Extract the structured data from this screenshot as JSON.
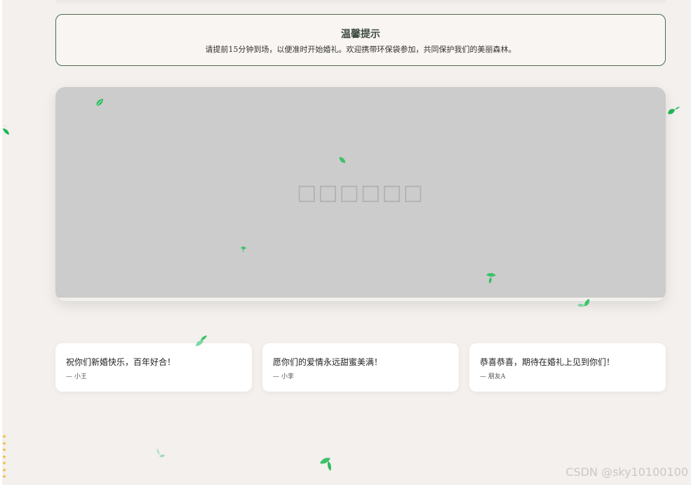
{
  "notice": {
    "title": "温馨提示",
    "body": "请提前15分钟到场，以便准时开始婚礼。欢迎携带环保袋参加，共同保护我们的美丽森林。"
  },
  "photo": {
    "placeholder_text": "□□□□□□"
  },
  "wishes": [
    {
      "message": "祝你们新婚快乐，百年好合！",
      "author": "— 小王"
    },
    {
      "message": "愿你们的爱情永远甜蜜美满！",
      "author": "— 小李"
    },
    {
      "message": "恭喜恭喜，期待在婚礼上见到你们！",
      "author": "— 朋友A"
    }
  ],
  "decor": {
    "leaf_icon": "leaf-icon",
    "leaf_color": "#3cc36a",
    "star_icon": "star-icon",
    "star_color": "#f0b52a"
  },
  "watermark": "CSDN @sky10100100"
}
